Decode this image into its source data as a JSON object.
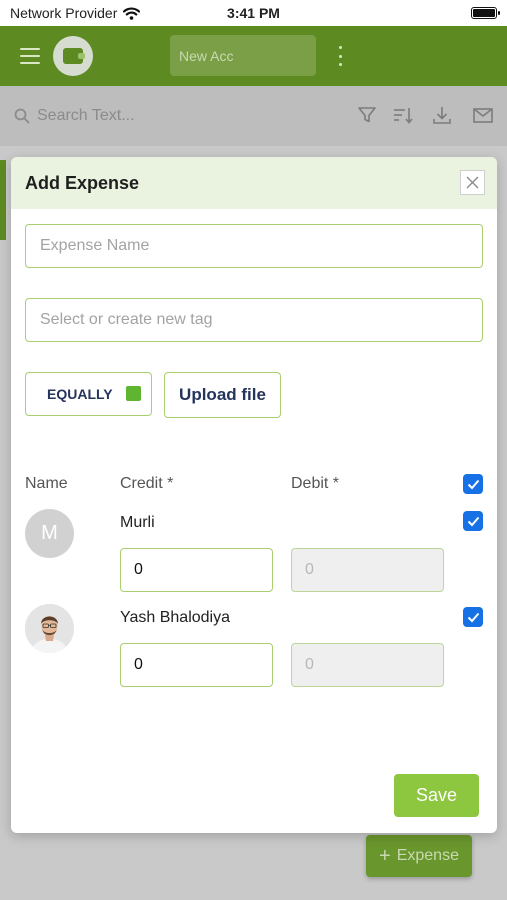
{
  "status_bar": {
    "carrier": "Network Provider",
    "time": "3:41 PM"
  },
  "app_bar": {
    "account_selector": "New Acc"
  },
  "search": {
    "placeholder": "Search Text..."
  },
  "fab": {
    "label": "Expense"
  },
  "modal": {
    "title": "Add Expense",
    "expense_name_placeholder": "Expense Name",
    "tag_placeholder": "Select or create new tag",
    "split_mode_label": "EQUALLY",
    "upload_label": "Upload file",
    "columns": {
      "name": "Name",
      "credit": "Credit *",
      "debit": "Debit *"
    },
    "members": [
      {
        "name": "Murli",
        "initial": "M",
        "credit": "0",
        "debit": "0",
        "checked": true
      },
      {
        "name": "Yash Bhalodiya",
        "credit": "0",
        "debit": "0",
        "checked": true
      }
    ],
    "save_label": "Save"
  },
  "colors": {
    "primary_green": "#8dc63f",
    "header_tint": "#eaf3df",
    "checkbox_blue": "#1670e6",
    "button_text_navy": "#24345c"
  }
}
